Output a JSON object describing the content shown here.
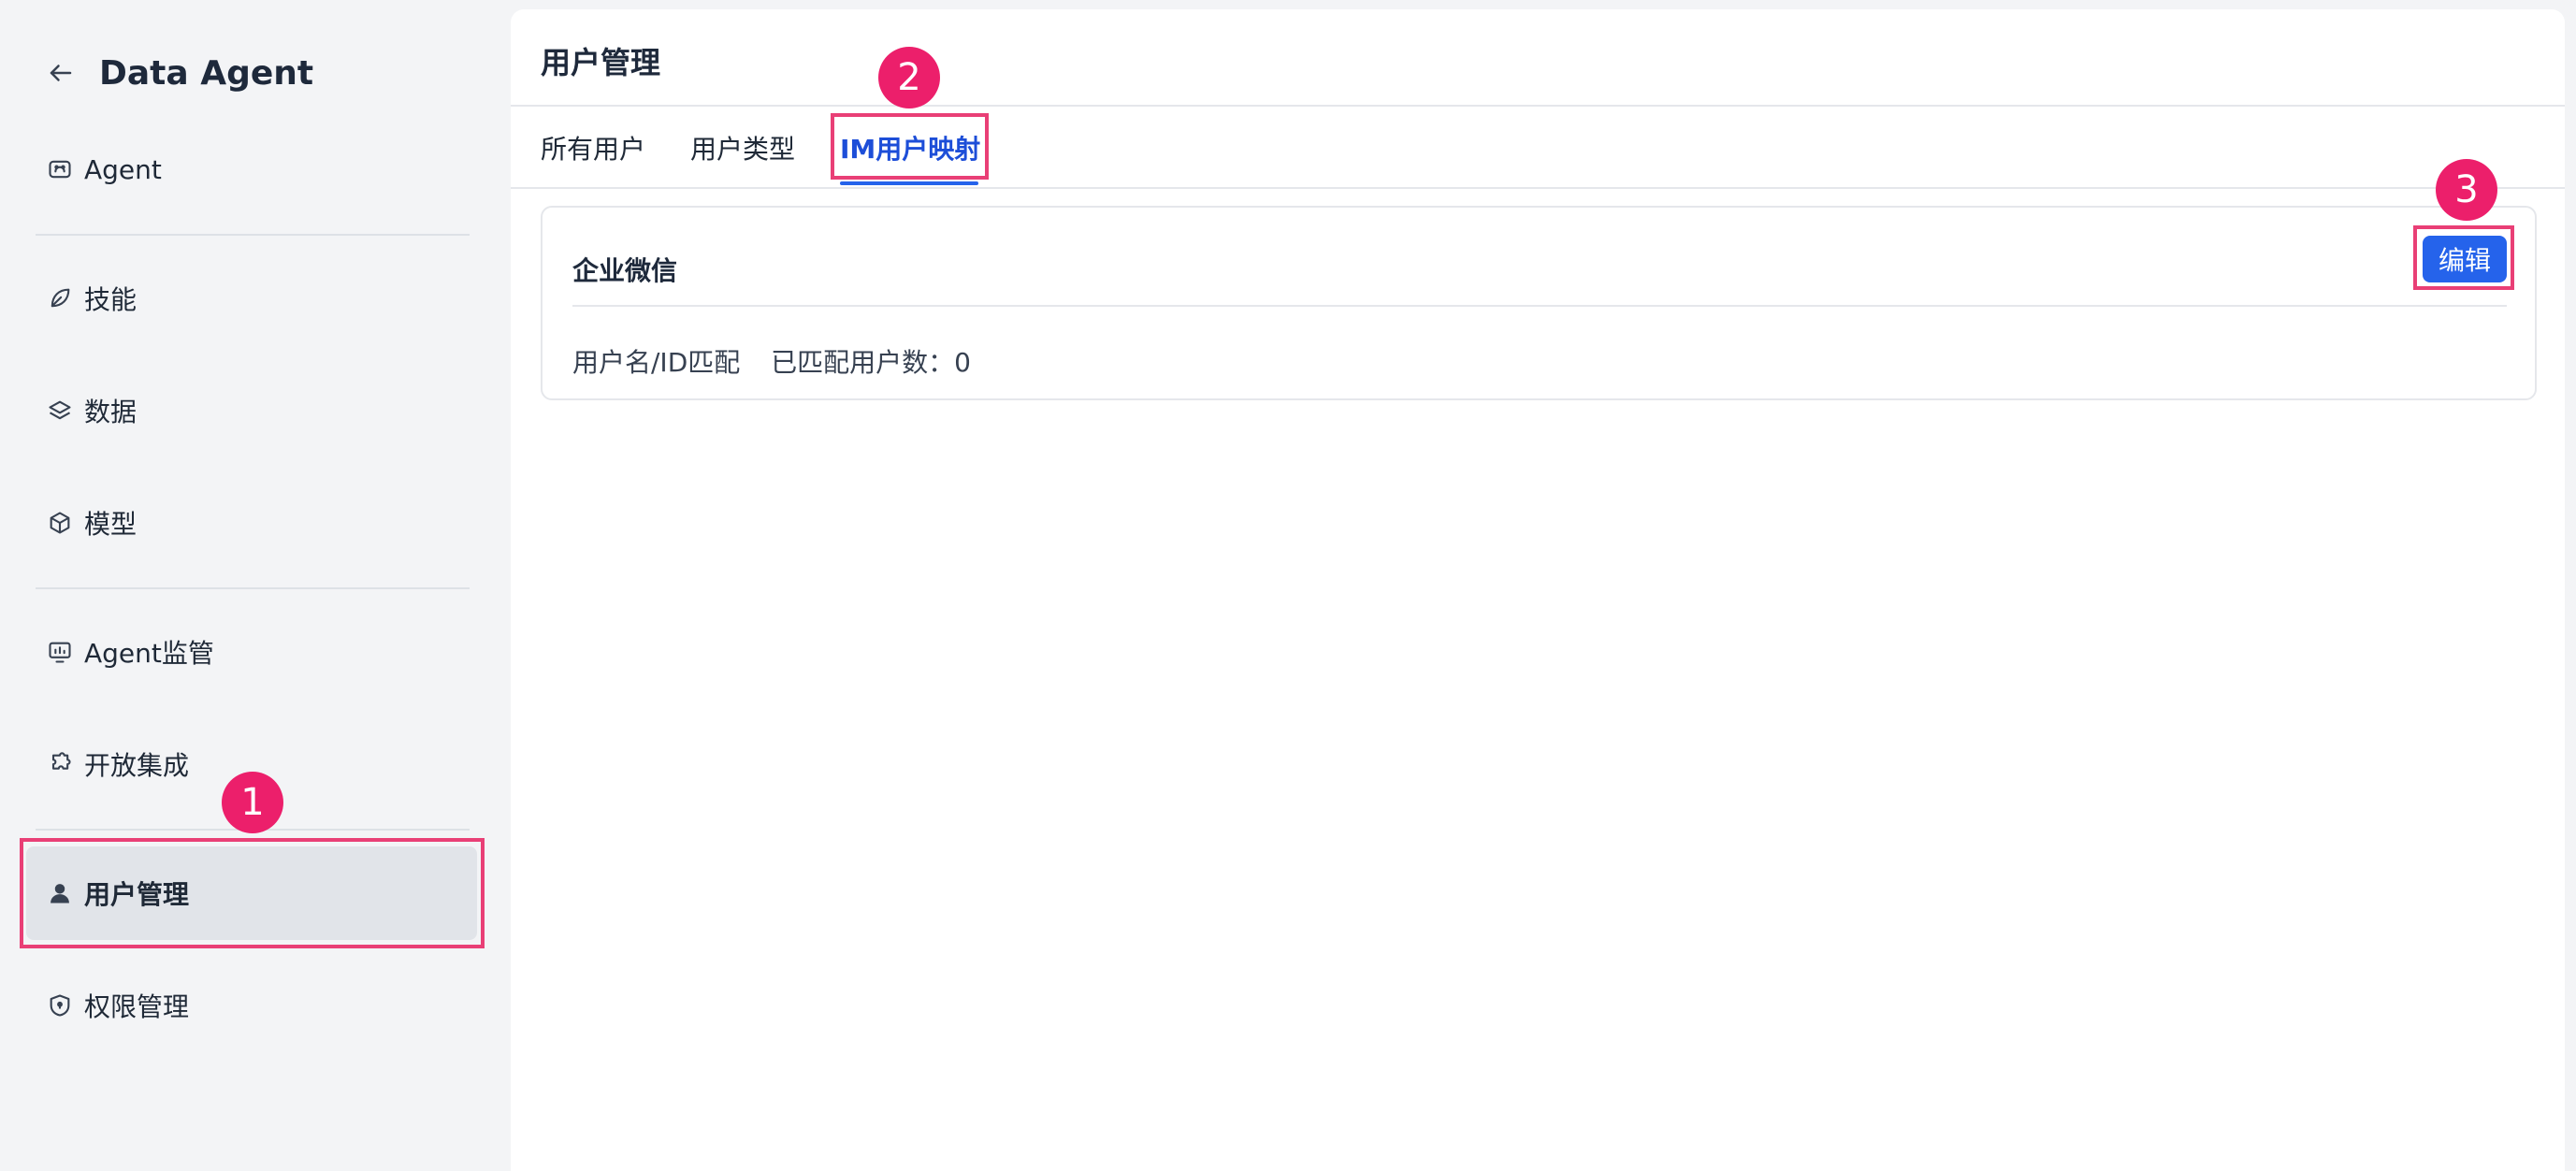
{
  "app": {
    "title": "Data Agent"
  },
  "sidebar": {
    "items": [
      {
        "label": "Agent",
        "icon": "agent-icon"
      },
      {
        "label": "技能",
        "icon": "leaf-icon"
      },
      {
        "label": "数据",
        "icon": "layers-icon"
      },
      {
        "label": "模型",
        "icon": "cube-icon"
      },
      {
        "label": "Agent监管",
        "icon": "monitor-icon"
      },
      {
        "label": "开放集成",
        "icon": "puzzle-icon"
      },
      {
        "label": "用户管理",
        "icon": "user-icon",
        "active": true
      },
      {
        "label": "权限管理",
        "icon": "shield-icon"
      }
    ]
  },
  "main": {
    "title": "用户管理",
    "tabs": [
      {
        "label": "所有用户"
      },
      {
        "label": "用户类型"
      },
      {
        "label": "IM用户映射",
        "active": true
      }
    ],
    "card": {
      "title": "企业微信",
      "edit_label": "编辑",
      "match_mode": "用户名/ID匹配",
      "matched_count": "已匹配用户数：0"
    }
  },
  "annotations": [
    {
      "number": "1"
    },
    {
      "number": "2"
    },
    {
      "number": "3"
    }
  ],
  "colors": {
    "accent": "#2563eb",
    "annotation": "#ec1f6b",
    "sidebar_bg": "#f3f4f6",
    "active_item_bg": "#e1e4e9"
  }
}
